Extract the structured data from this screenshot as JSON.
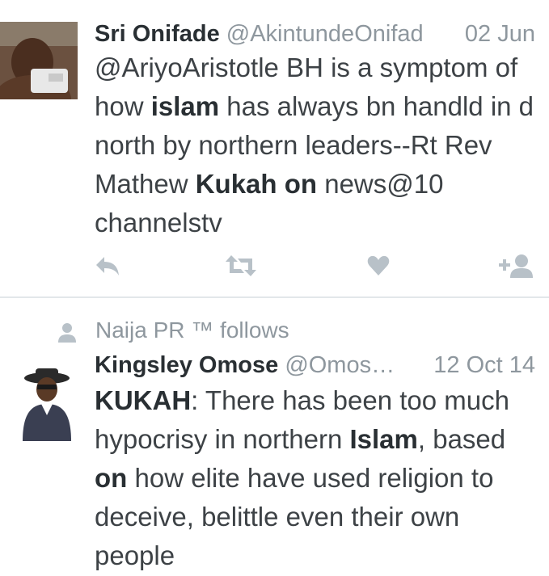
{
  "tweets": [
    {
      "name": "Sri Onifade",
      "handle": "@AkintundeOnifad",
      "date": "02 Jun",
      "text_segments": [
        {
          "text": "@AriyoAristotle BH is a symptom of how ",
          "bold": false
        },
        {
          "text": "islam",
          "bold": true
        },
        {
          "text": " has always bn handld in d north by  northern leaders--Rt Rev Mathew ",
          "bold": false
        },
        {
          "text": "Kukah on",
          "bold": true
        },
        {
          "text": " news@10 channelstv",
          "bold": false
        }
      ],
      "actions": [
        "reply-icon",
        "retweet-icon",
        "favorite-icon",
        "follow-icon"
      ]
    },
    {
      "context": "Naija PR ™ follows",
      "name": "Kingsley Omose",
      "handle": "@Omos…",
      "date": "12 Oct 14",
      "text_segments": [
        {
          "text": "KUKAH",
          "bold": true
        },
        {
          "text": ": There has been too much hypocrisy in northern ",
          "bold": false
        },
        {
          "text": "Islam",
          "bold": true
        },
        {
          "text": ", based ",
          "bold": false
        },
        {
          "text": "on",
          "bold": true
        },
        {
          "text": " how elite have used religion to deceive, belittle even their own people",
          "bold": false
        }
      ]
    }
  ],
  "colors": {
    "icon": "#b8c1c8",
    "meta": "#8e979e",
    "text": "#3d4246",
    "divider": "#e3e7ea"
  }
}
